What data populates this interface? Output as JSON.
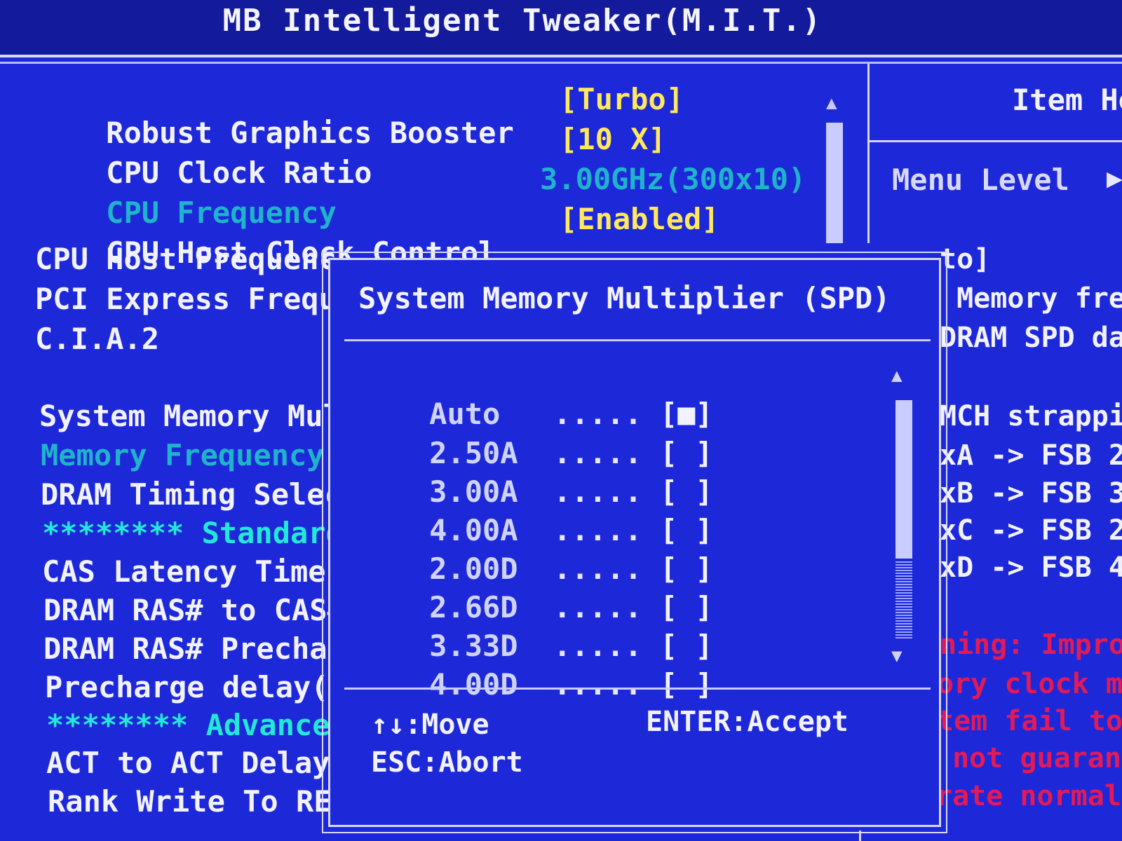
{
  "window": {
    "title": "MB Intelligent Tweaker(M.I.T.)"
  },
  "colors": {
    "background": "#1d28d8",
    "value": "#ffe860",
    "disabled": "#1fb3cc",
    "section": "#22e8d8",
    "warning": "#e21a58",
    "text": "#f2f2ff"
  },
  "main": {
    "items": [
      {
        "label": "Robust Graphics Booster",
        "value": "[Turbo]"
      },
      {
        "label": "CPU Clock Ratio",
        "value": "[10 X]"
      },
      {
        "label": "CPU Frequency",
        "value": "3.00GHz(300x10)"
      },
      {
        "label": "CPU Host Clock Control",
        "value": "[Enabled]"
      },
      {
        "label": "CPU Host Frequenc"
      },
      {
        "label": "PCI Express Frequ"
      },
      {
        "label": "C.I.A.2"
      },
      {
        "label": "System Memory Mul"
      },
      {
        "label": "Memory Frequency("
      },
      {
        "label": "DRAM Timing Selec"
      },
      {
        "label": "******** Standard"
      },
      {
        "label": "CAS Latency Time"
      },
      {
        "label": "DRAM RAS# to CAS#"
      },
      {
        "label": "DRAM RAS# Prechar"
      },
      {
        "label": "Precharge delay(t"
      },
      {
        "label": "******** Advanced"
      },
      {
        "label": "ACT to ACT Delay("
      },
      {
        "label": "Rank Write To REA"
      }
    ],
    "scroll_up_icon": "▲"
  },
  "help": {
    "title": "Item He",
    "menu_level": "Menu Level",
    "menu_level_arrow": "▶",
    "lines": [
      "to]",
      " Memory fre",
      "DRAM SPD da",
      "MCH strappi",
      "xA -> FSB 2",
      "xB -> FSB 3",
      "xC -> FSB 2",
      "xD -> FSB 4"
    ],
    "warning_lines": [
      "ning: Impro",
      "ory clock ma",
      "tem fail to",
      " not guarant",
      "rate normal"
    ]
  },
  "popup": {
    "title": "System Memory Multiplier (SPD)",
    "options": [
      {
        "value": "Auto",
        "dots": ".....",
        "box": "[■]"
      },
      {
        "value": "2.50A",
        "dots": ".....",
        "box": "[ ]"
      },
      {
        "value": "3.00A",
        "dots": ".....",
        "box": "[ ]"
      },
      {
        "value": "4.00A",
        "dots": ".....",
        "box": "[ ]"
      },
      {
        "value": "2.00D",
        "dots": ".....",
        "box": "[ ]"
      },
      {
        "value": "2.66D",
        "dots": ".....",
        "box": "[ ]"
      },
      {
        "value": "3.33D",
        "dots": ".....",
        "box": "[ ]"
      },
      {
        "value": "4.00D",
        "dots": ".....",
        "box": "[ ]"
      }
    ],
    "scroll_up": "▲",
    "scroll_down": "▼",
    "keys": {
      "move": "↑↓:Move",
      "accept": "ENTER:Accept",
      "abort": "ESC:Abort"
    }
  }
}
